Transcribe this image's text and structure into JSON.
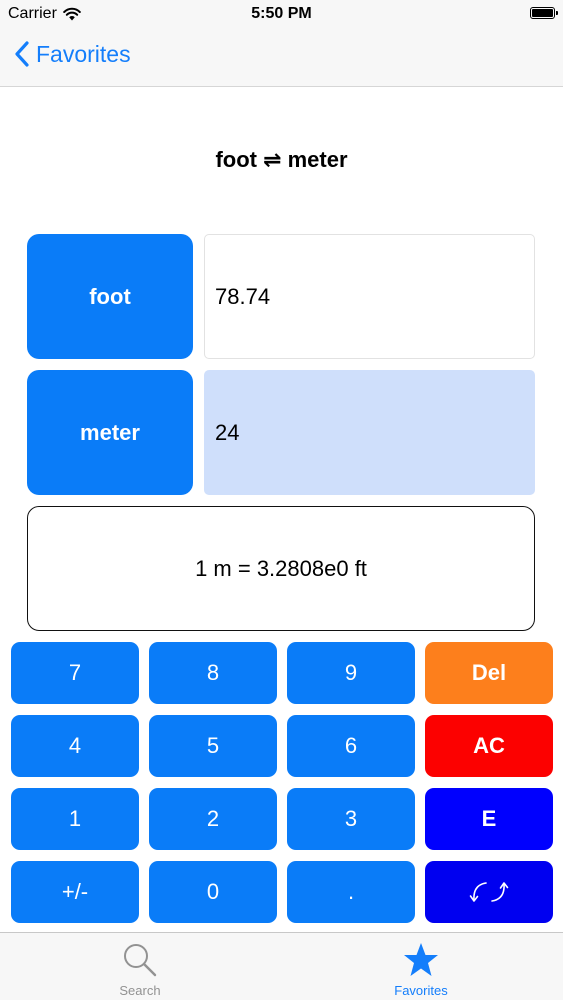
{
  "status_bar": {
    "carrier": "Carrier",
    "time": "5:50 PM"
  },
  "nav": {
    "back_label": "Favorites"
  },
  "title": "foot ⇌ meter",
  "units": {
    "top": {
      "label": "foot",
      "value": "78.74"
    },
    "bottom": {
      "label": "meter",
      "value": "24"
    }
  },
  "conversion_factor": "1 m = 3.2808e0 ft",
  "keypad": {
    "k7": "7",
    "k8": "8",
    "k9": "9",
    "del": "Del",
    "k4": "4",
    "k5": "5",
    "k6": "6",
    "ac": "AC",
    "k1": "1",
    "k2": "2",
    "k3": "3",
    "exp": "E",
    "sign": "+/-",
    "k0": "0",
    "dot": "."
  },
  "tab_bar": {
    "search_label": "Search",
    "favorites_label": "Favorites"
  },
  "colors": {
    "accent": "#147efb",
    "key_blue": "#0a7cf8",
    "del": "#fd7f1c",
    "ac": "#fc0100",
    "exp": "#0000fe",
    "swap": "#0000f0",
    "highlight_field": "#cfdffb",
    "tab_inactive": "#929292"
  },
  "icons": {
    "back": "chevron-left-icon",
    "wifi": "wifi-icon",
    "battery": "battery-icon",
    "swap": "swap-arrows-icon",
    "search": "search-icon",
    "favorites": "star-icon"
  }
}
